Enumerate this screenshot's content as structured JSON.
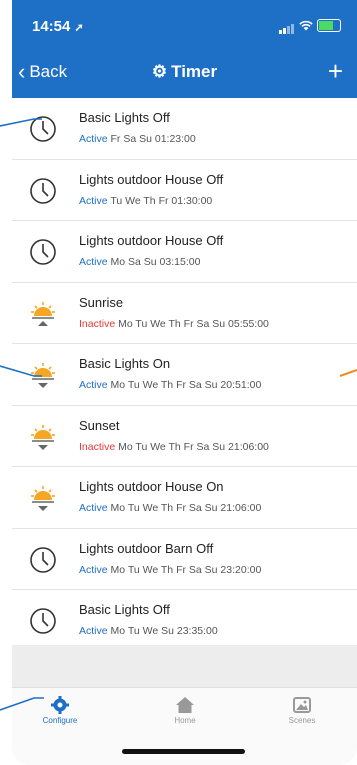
{
  "status": {
    "time": "14:54",
    "location_icon": "location-arrow-icon"
  },
  "nav": {
    "back_label": "Back",
    "title": "Timer",
    "plus": "+"
  },
  "timers": [
    {
      "name": "Basic Lights Off",
      "status": "Active",
      "schedule": "Fr Sa Su 01:23:00",
      "icon": "clock-icon"
    },
    {
      "name": "Lights outdoor House Off",
      "status": "Active",
      "schedule": "Tu We Th Fr 01:30:00",
      "icon": "clock-icon"
    },
    {
      "name": "Lights outdoor House Off",
      "status": "Active",
      "schedule": "Mo Sa Su 03:15:00",
      "icon": "clock-icon"
    },
    {
      "name": "Sunrise",
      "status": "Inactive",
      "schedule": "Mo Tu We Th Fr Sa Su 05:55:00",
      "icon": "sunrise-icon"
    },
    {
      "name": "Basic Lights On",
      "status": "Active",
      "schedule": "Mo Tu We Th Fr Sa Su 20:51:00",
      "icon": "sunset-icon"
    },
    {
      "name": "Sunset",
      "status": "Inactive",
      "schedule": "Mo Tu We Th Fr Sa Su 21:06:00",
      "icon": "sunset-icon"
    },
    {
      "name": "Lights outdoor House On",
      "status": "Active",
      "schedule": "Mo Tu We Th Fr Sa Su 21:06:00",
      "icon": "sunset-icon"
    },
    {
      "name": "Lights outdoor Barn Off",
      "status": "Active",
      "schedule": "Mo Tu We Th Fr Sa Su 23:20:00",
      "icon": "clock-icon"
    },
    {
      "name": "Basic Lights Off",
      "status": "Active",
      "schedule": "Mo Tu We Su 23:35:00",
      "icon": "clock-icon"
    }
  ],
  "tabs": [
    {
      "label": "Configure",
      "icon": "gear-icon",
      "active": true
    },
    {
      "label": "Home",
      "icon": "house-icon",
      "active": false
    },
    {
      "label": "Scenes",
      "icon": "image-icon",
      "active": false
    }
  ],
  "colors": {
    "accent": "#1e6fc6",
    "inactive": "#e53935",
    "sun": "#f5a623",
    "callout_line": "#1e6fc6",
    "callout_orange": "#f08a24"
  }
}
